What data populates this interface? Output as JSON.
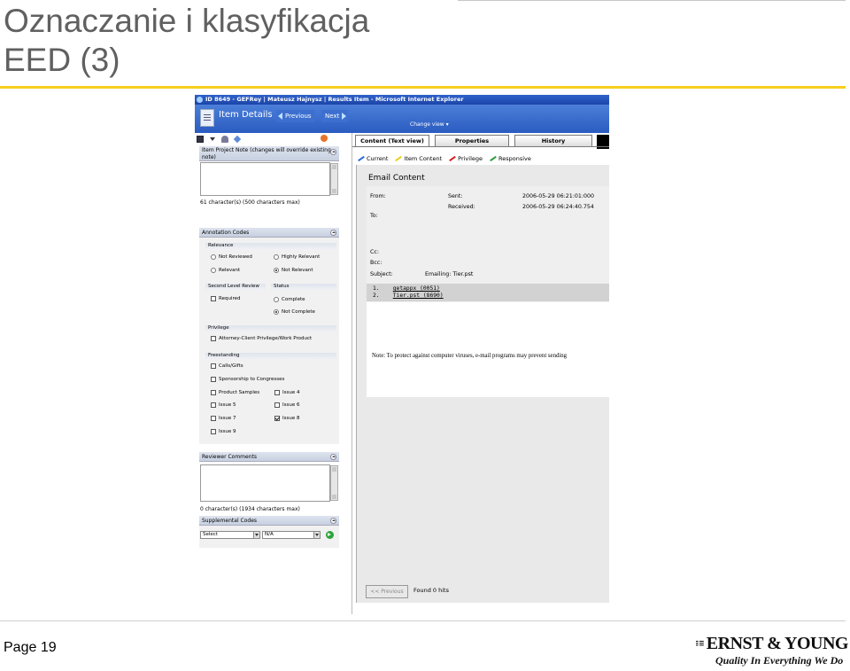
{
  "slide": {
    "title_line1": "Oznaczanie i klasyfikacja",
    "title_line2": "EED (3)",
    "page": "Page 19",
    "logo_name": "ERNST & YOUNG",
    "logo_tagline": "Quality In Everything We Do"
  },
  "colors": {
    "title": "#606060",
    "accent_rule": "#f5cf1d",
    "window_blue": "#2f62c9"
  },
  "window": {
    "title": "ID 8649 - GEFRey | Mateusz Hajnysz | Results Item - Microsoft Internet Explorer",
    "page_title": "Item Details",
    "previous_label": "Previous",
    "next_label": "Next",
    "change_view": "Change view ▾"
  },
  "toolbar": {
    "icons": [
      "save-icon",
      "dropdown-icon",
      "user-icon",
      "tag-icon",
      "stop-icon"
    ]
  },
  "note_panel": {
    "header": "Item Project Note (changes will override existing note)",
    "char_count": "61 character(s) (500 characters max)"
  },
  "annotation": {
    "header": "Annotation Codes",
    "relevance": {
      "label": "Relevance",
      "options": [
        {
          "label": "Not Reviewed",
          "checked": false
        },
        {
          "label": "Highly Relevant",
          "checked": false
        },
        {
          "label": "Relevant",
          "checked": false
        },
        {
          "label": "Not Relevant",
          "checked": true
        }
      ]
    },
    "second_level": {
      "label": "Second Level Review",
      "required": "Required",
      "required_checked": false
    },
    "status": {
      "label": "Status",
      "options": [
        {
          "label": "Complete",
          "checked": false
        },
        {
          "label": "Not Complete",
          "checked": true
        }
      ]
    },
    "privilege": {
      "label": "Privilege",
      "option": "Attorney-Client Privilege/Work Product",
      "checked": false
    },
    "freestanding": {
      "label": "Freestanding",
      "items": [
        {
          "label": "Calls/Gifts",
          "checked": false
        },
        {
          "label": "Sponsorship to Congresses",
          "checked": false
        },
        {
          "label": "Product Samples",
          "checked": false
        },
        {
          "label": "Issue 4",
          "checked": false
        },
        {
          "label": "Issue 5",
          "checked": false
        },
        {
          "label": "Issue 6",
          "checked": false
        },
        {
          "label": "Issue 7",
          "checked": false
        },
        {
          "label": "Issue 8",
          "checked": true
        },
        {
          "label": "Issue 9",
          "checked": false
        }
      ]
    }
  },
  "reviewer": {
    "header": "Reviewer Comments",
    "char_count": "0 character(s) (1934 characters max)"
  },
  "supplemental": {
    "header": "Supplemental Codes",
    "select1": "Select",
    "select2": "N/A"
  },
  "tabs": [
    {
      "label": "Content (Text view)",
      "active": true
    },
    {
      "label": "Properties",
      "active": false
    },
    {
      "label": "History",
      "active": false
    }
  ],
  "legend": [
    {
      "label": "Current",
      "color": "#2a6ad6"
    },
    {
      "label": "Item Content",
      "color": "#e8d020"
    },
    {
      "label": "Privilege",
      "color": "#d62020"
    },
    {
      "label": "Responsive",
      "color": "#2a9d3a"
    }
  ],
  "email": {
    "heading": "Email Content",
    "from_label": "From:",
    "sent_label": "Sent:",
    "sent_value": "2006-05-29 06:21:01:000",
    "received_label": "Received:",
    "received_value": "2006-05-29 06:24:40.754",
    "to_label": "To:",
    "cc_label": "Cc:",
    "bcc_label": "Bcc:",
    "subject_label": "Subject:",
    "subject_value": "Emailing: Tier.pst",
    "attachments": [
      {
        "num": "1.",
        "name": "getappx (0051)"
      },
      {
        "num": "2.",
        "name": "Tier.pst (8690)"
      }
    ],
    "note": "Note: To protect against computer viruses, e-mail programs may prevent sending"
  },
  "footer": {
    "previous_button": "<< Previous",
    "found": "Found 0 hits"
  }
}
